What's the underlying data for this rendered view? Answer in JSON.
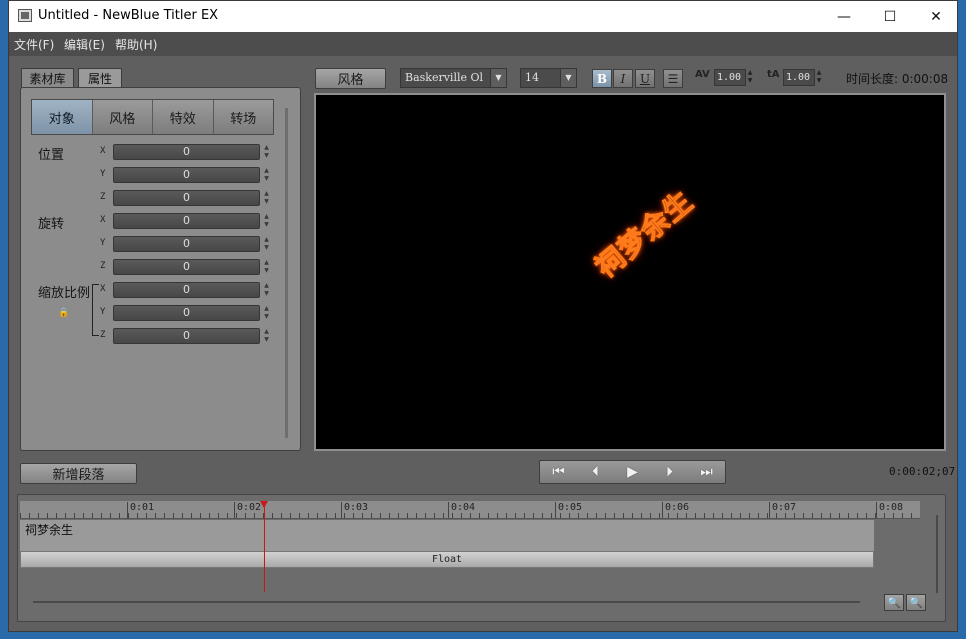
{
  "window": {
    "title": "Untitled - NewBlue Titler EX",
    "minimize": "—",
    "maximize": "☐",
    "close": "✕"
  },
  "menu": [
    "文件(F)",
    "编辑(E)",
    "帮助(H)"
  ],
  "left_tabs": {
    "library": "素材库",
    "properties": "属性"
  },
  "sub_tabs": [
    "对象",
    "风格",
    "特效",
    "转场"
  ],
  "properties": {
    "position_label": "位置",
    "rotation_label": "旋转",
    "scale_label": "缩放比例",
    "axes": [
      "X",
      "Y",
      "Z",
      "X",
      "Y",
      "Z",
      "X",
      "Y",
      "Z"
    ],
    "values": [
      "0",
      "0",
      "0",
      "0",
      "0",
      "0",
      "0",
      "0",
      "0"
    ]
  },
  "toolbar": {
    "style_button": "风格",
    "font": "Baskerville Ol",
    "font_size": "14",
    "bold": "B",
    "italic": "I",
    "underline": "U",
    "tracking_value": "1.00",
    "leading_value": "1.00",
    "duration_label": "时间长度: 0:00:08"
  },
  "preview": {
    "text": "祠梦余生"
  },
  "new_segment_button": "新增段落",
  "transport": {
    "current_time": "0:00:02;07"
  },
  "timeline": {
    "ticks": [
      "0:01",
      "0:02",
      "0:03",
      "0:04",
      "0:05",
      "0:06",
      "0:07",
      "0:08"
    ],
    "track_name": "祠梦余生",
    "effect": "Float",
    "playhead_time": "0:00:02;07"
  }
}
